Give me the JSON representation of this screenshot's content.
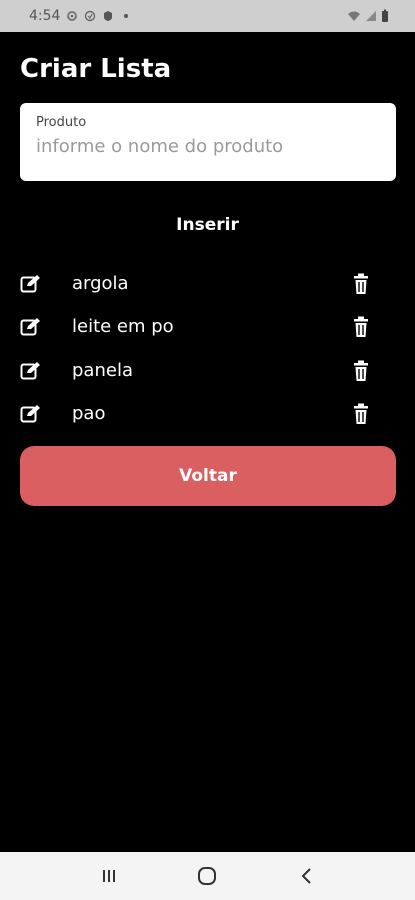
{
  "status_bar": {
    "time": "4:54",
    "left_icons": [
      "gear-icon",
      "circle-icon",
      "dot-icon"
    ],
    "right_icons": [
      "wifi-icon",
      "signal-icon",
      "battery-icon"
    ]
  },
  "header": {
    "title": "Criar Lista"
  },
  "product_input": {
    "label": "Produto",
    "placeholder": "informe o nome do produto",
    "value": ""
  },
  "insert_label": "Inserir",
  "items": [
    {
      "name": "argola"
    },
    {
      "name": "leite em po"
    },
    {
      "name": "panela"
    },
    {
      "name": "pao"
    }
  ],
  "back_label": "Voltar",
  "colors": {
    "accent": "#d95f60",
    "background": "#000000"
  },
  "nav": [
    "recent-apps-icon",
    "home-icon",
    "back-icon"
  ]
}
